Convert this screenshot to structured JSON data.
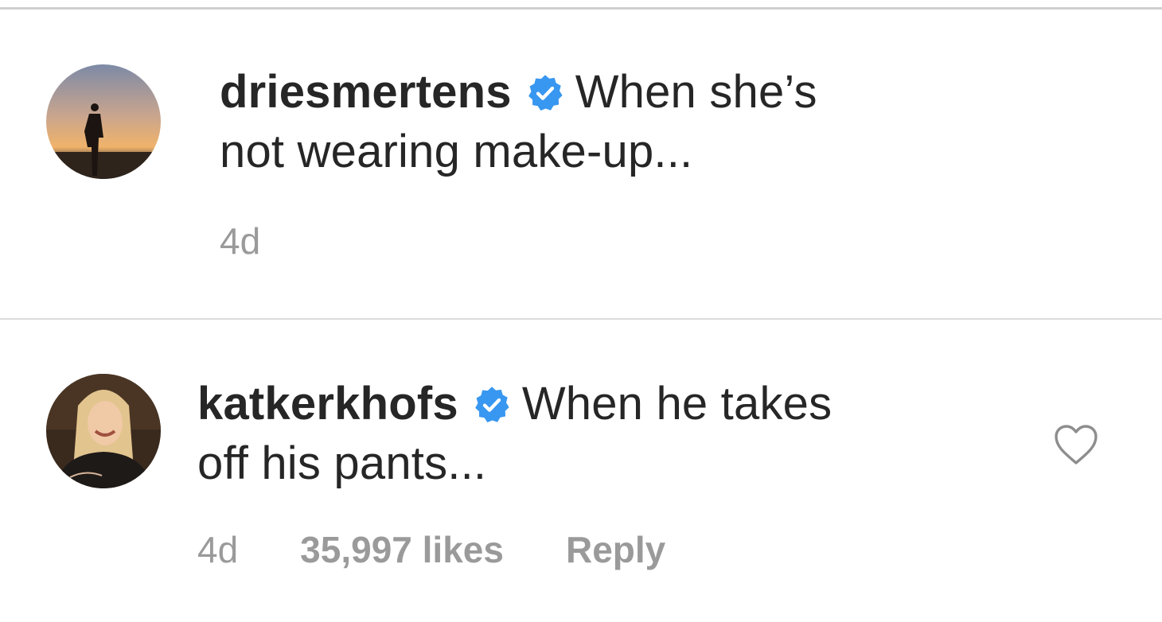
{
  "comments": [
    {
      "username": "driesmertens",
      "verified": true,
      "text_line1": "When she’s",
      "text_line2": "not wearing make-up...",
      "time": "4d",
      "avatar_icon": "sunset-silhouette-avatar"
    },
    {
      "username": "katkerkhofs",
      "verified": true,
      "text_line1": "When he takes",
      "text_line2": "off his pants...",
      "time": "4d",
      "likes": "35,997 likes",
      "reply": "Reply",
      "avatar_icon": "woman-laughing-avatar",
      "like_icon": "heart-outline-icon"
    }
  ],
  "colors": {
    "text": "#262626",
    "meta": "#9a9a9a",
    "verified": "#3897f0",
    "divider": "#dbdbdb"
  }
}
